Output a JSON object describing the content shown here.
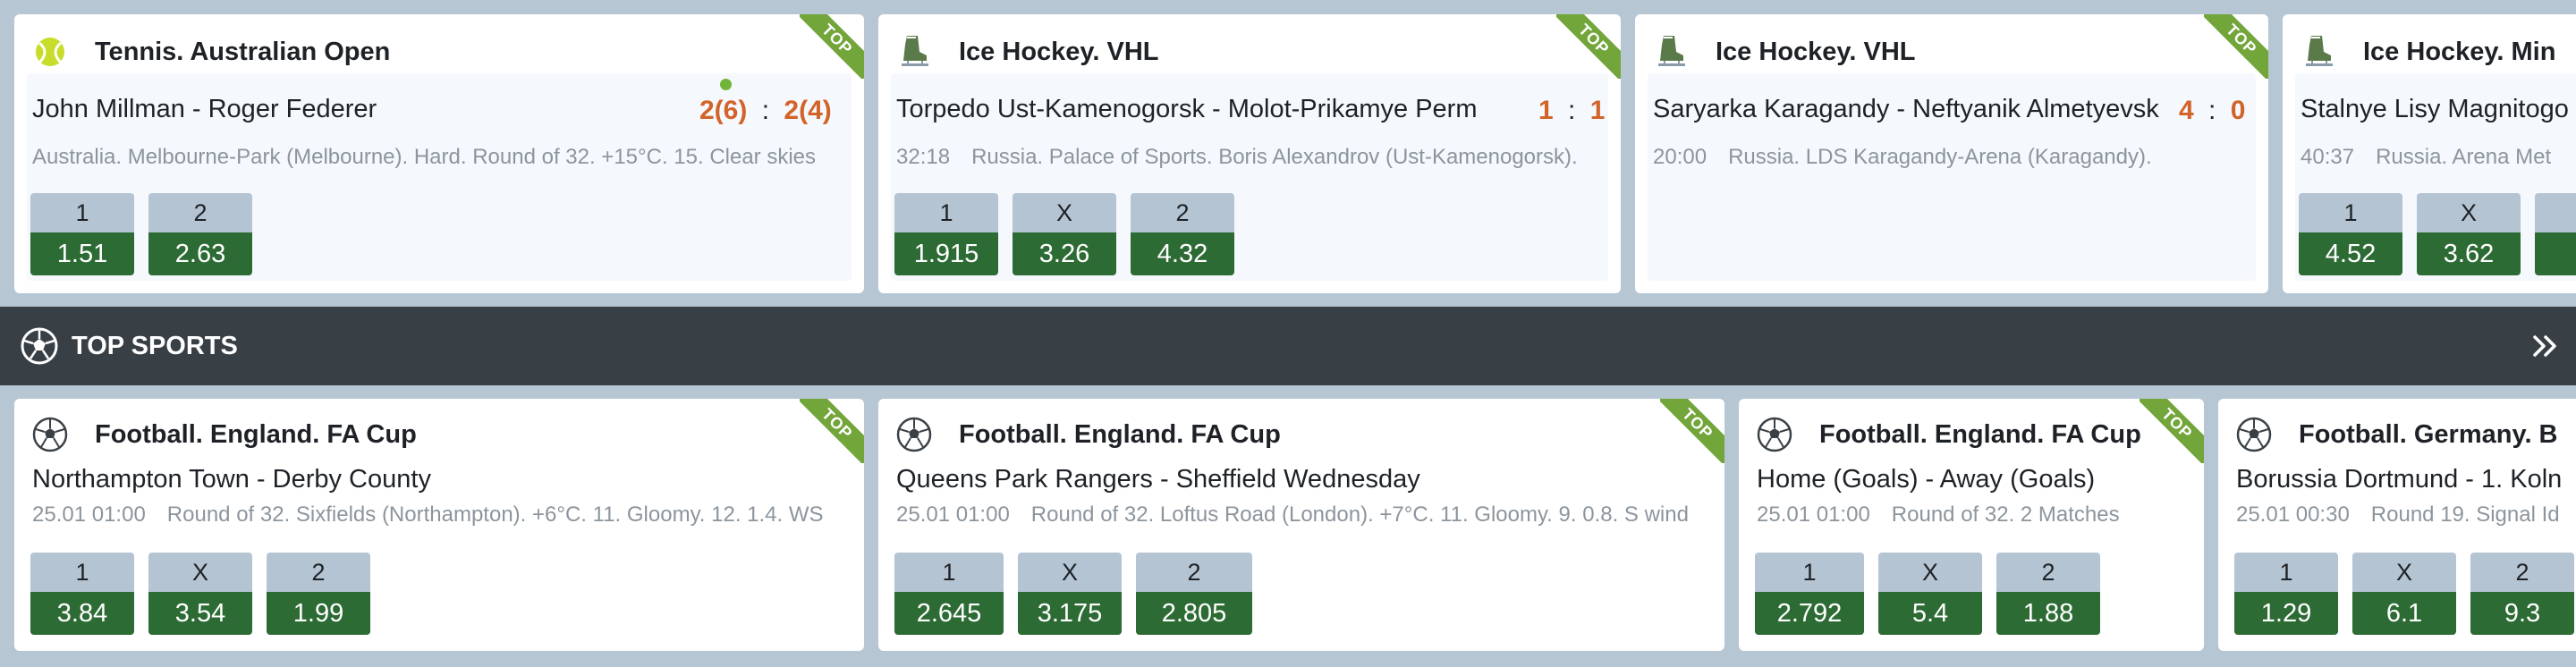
{
  "live_events": [
    {
      "sport_icon": "tennis-ball-icon",
      "title": "Tennis. Australian Open",
      "teams": "John Millman - Roger Federer",
      "score_home": "2(6)",
      "score_sep": ":",
      "score_away": "2(4)",
      "serving_indicator": true,
      "time": "",
      "info": "Australia. Melbourne-Park (Melbourne). Hard. Round of 32. +15°C. 15. Clear skies",
      "badge": "TOP",
      "odds": [
        {
          "label": "1",
          "value": "1.51"
        },
        {
          "label": "2",
          "value": "2.63"
        }
      ]
    },
    {
      "sport_icon": "ice-skate-icon",
      "title": "Ice Hockey. VHL",
      "teams": "Torpedo Ust-Kamenogorsk - Molot-Prikamye Perm",
      "score_home": "1",
      "score_sep": ":",
      "score_away": "1",
      "time": "32:18",
      "info": "Russia. Palace of Sports. Boris Alexandrov (Ust-Kamenogorsk).",
      "badge": "TOP",
      "odds": [
        {
          "label": "1",
          "value": "1.915"
        },
        {
          "label": "X",
          "value": "3.26"
        },
        {
          "label": "2",
          "value": "4.32"
        }
      ]
    },
    {
      "sport_icon": "ice-skate-icon",
      "title": "Ice Hockey. VHL",
      "teams": "Saryarka Karagandy - Neftyanik Almetyevsk",
      "score_home": "4",
      "score_sep": ":",
      "score_away": "0",
      "time": "20:00",
      "info": "Russia. LDS Karagandy-Arena (Karagandy).",
      "badge": "TOP",
      "odds": []
    },
    {
      "sport_icon": "ice-skate-icon",
      "title": "Ice Hockey. Min",
      "teams": "Stalnye Lisy Magnitogo",
      "time": "40:37",
      "info": "Russia. Arena Met",
      "odds": [
        {
          "label": "1",
          "value": "4.52"
        },
        {
          "label": "X",
          "value": "3.62"
        },
        {
          "label": "",
          "value": ""
        }
      ]
    }
  ],
  "top_sports": {
    "icon": "soccer-ball-icon",
    "title": "TOP SPORTS",
    "more_icon": "double-chevron-right-icon"
  },
  "top_events": [
    {
      "sport_icon": "soccer-ball-icon",
      "title": "Football. England. FA Cup",
      "teams": "Northampton Town - Derby County",
      "time": "25.01 01:00",
      "info": "Round of 32. Sixfields (Northampton). +6°C. 11. Gloomy. 12. 1.4. WS",
      "badge": "TOP",
      "odds": [
        {
          "label": "1",
          "value": "3.84"
        },
        {
          "label": "X",
          "value": "3.54"
        },
        {
          "label": "2",
          "value": "1.99"
        }
      ]
    },
    {
      "sport_icon": "soccer-ball-icon",
      "title": "Football. England. FA Cup",
      "teams": "Queens Park Rangers - Sheffield Wednesday",
      "time": "25.01 01:00",
      "info": "Round of 32. Loftus Road (London). +7°C. 11. Gloomy. 9. 0.8. S wind",
      "badge": "TOP",
      "odds": [
        {
          "label": "1",
          "value": "2.645"
        },
        {
          "label": "X",
          "value": "3.175"
        },
        {
          "label": "2",
          "value": "2.805"
        }
      ]
    },
    {
      "sport_icon": "soccer-ball-icon",
      "title": "Football. England. FA Cup",
      "teams": "Home (Goals) - Away (Goals)",
      "time": "25.01 01:00",
      "info": "Round of 32. 2 Matches",
      "badge": "TOP",
      "odds": [
        {
          "label": "1",
          "value": "2.792"
        },
        {
          "label": "X",
          "value": "5.4"
        },
        {
          "label": "2",
          "value": "1.88"
        }
      ]
    },
    {
      "sport_icon": "soccer-ball-icon",
      "title": "Football. Germany. B",
      "teams": "Borussia Dortmund - 1. Koln",
      "time": "25.01 00:30",
      "info": "Round 19. Signal Id",
      "odds": [
        {
          "label": "1",
          "value": "1.29"
        },
        {
          "label": "X",
          "value": "6.1"
        },
        {
          "label": "2",
          "value": "9.3"
        }
      ]
    }
  ],
  "colors": {
    "page_bg": "#b7c6d3",
    "bar_bg": "#384046",
    "score": "#d2642a",
    "odd_value_bg": "#2d6b34",
    "odd_label_bg": "#b5c4d2",
    "badge": "#72a53a"
  }
}
